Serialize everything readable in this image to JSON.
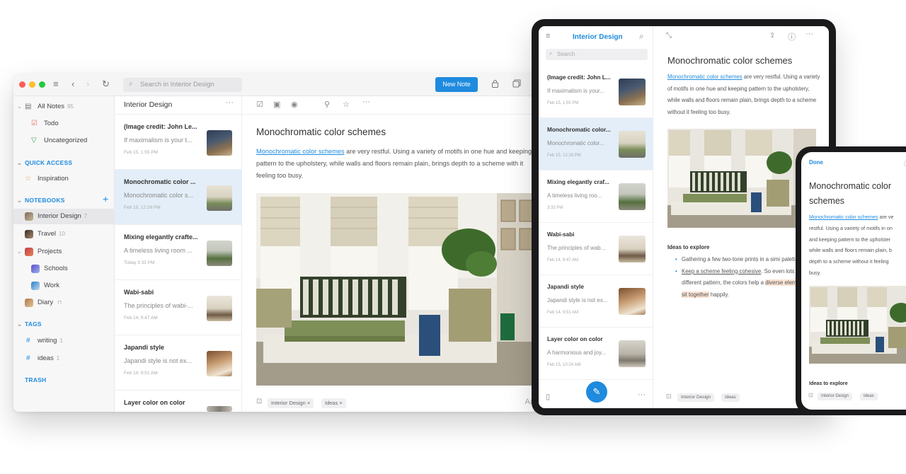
{
  "desktop": {
    "search_placeholder": "Search in Interior Design",
    "new_note_label": "New Note",
    "sidebar": {
      "all_notes": {
        "label": "All Notes",
        "count": "95"
      },
      "todo": "Todo",
      "uncategorized": "Uncategorized",
      "quick_access_header": "QUICK ACCESS",
      "inspiration": "Inspiration",
      "notebooks_header": "NOTEBOOKS",
      "notebooks": [
        {
          "label": "Interior Design",
          "count": "7"
        },
        {
          "label": "Travel",
          "count": "10"
        },
        {
          "label": "Projects",
          "count": ""
        },
        {
          "label": "Schools",
          "count": ""
        },
        {
          "label": "Work",
          "count": ""
        },
        {
          "label": "Diary",
          "count": ""
        }
      ],
      "tags_header": "TAGS",
      "tags": [
        {
          "label": "writing",
          "count": "1"
        },
        {
          "label": "ideas",
          "count": "1"
        }
      ],
      "trash": "TRASH"
    },
    "list": {
      "title": "Interior Design",
      "notes": [
        {
          "title": "(Image credit: John Le...",
          "snippet": "If maximalism is your t...",
          "date": "Feb 15, 1:55 PM"
        },
        {
          "title": "Monochromatic color ...",
          "snippet": "Monochromatic color s...",
          "date": "Feb 15, 12:26 PM"
        },
        {
          "title": "Mixing elegantly crafte...",
          "snippet": "A timeless living room ...",
          "date": "Today 3:33 PM"
        },
        {
          "title": "Wabi-sabi",
          "snippet": "The principles of wabi-...",
          "date": "Feb 14, 9:47 AM"
        },
        {
          "title": "Japandi style",
          "snippet": "Japandi style is not ex...",
          "date": "Feb 14, 9:51 AM"
        },
        {
          "title": "Layer color on color",
          "snippet": "",
          "date": ""
        }
      ]
    },
    "editor": {
      "title": "Monochromatic color schemes",
      "link_text": "Monochromatic color schemes",
      "body_rest": " are very restful. Using a variety of motifs in one hue and keeping pattern to the upholstery, while walls and floors remain plain, brings depth to a scheme with it feeling too busy.",
      "tags": [
        "Interior Design ×",
        "Ideas ×"
      ],
      "font_button": "Aa"
    }
  },
  "tablet": {
    "list_title": "Interior Design",
    "search_placeholder": "Search",
    "notes": [
      {
        "title": "(Image credit: John L...",
        "snippet": "If maximalism is your...",
        "date": "Feb 15, 1:55 PM"
      },
      {
        "title": "Monochromatic color...",
        "snippet": "Monochromatic color...",
        "date": "Feb 15, 12:26 PM"
      },
      {
        "title": "Mixing elegantly craf...",
        "snippet": "A timeless living roo...",
        "date": "3:33 PM"
      },
      {
        "title": "Wabi-sabi",
        "snippet": "The principles of wab...",
        "date": "Feb 14, 9:47 AM"
      },
      {
        "title": "Japandi style",
        "snippet": "Japandi style is not ex...",
        "date": "Feb 14, 9:51 AM"
      },
      {
        "title": "Layer color on color",
        "snippet": "A harmonious and joy...",
        "date": "Feb 15, 10:24 AM"
      }
    ],
    "editor": {
      "title": "Monochromatic color schemes",
      "link_text": "Monochromatic color schemes",
      "body_rest": " are very restful. Using a variety of motifs in one hue and keeping pattern to the upholstery, while walls and floors remain plain, brings depth to a scheme without it feeling too busy.",
      "ideas_heading": "Ideas to explore",
      "bullet1": "Gathering a few two-tone prints in a simi palette",
      "bullet2_underlined": "Keep a scheme feeling cohesive",
      "bullet2_rest": ". So even lots of different pattern, the colors help a",
      "bullet2_highlight": "diverse elements to sit together",
      "bullet2_end": " happily.",
      "tags": [
        "Interior Design",
        "Ideas"
      ]
    }
  },
  "phone": {
    "done_label": "Done",
    "title": "Monochromatic color schemes",
    "body_lines": [
      " are ve",
      "restful. Using a variety of motifs in on",
      "and keeping pattern to the upholster",
      "while walls and floors remain plain, b",
      "depth to a scheme without it feeling",
      "busy."
    ],
    "link_text": "Monochromatic color schemes",
    "ideas_heading": "Ideas to explore",
    "tags": [
      "Interior Design",
      "Ideas"
    ]
  }
}
